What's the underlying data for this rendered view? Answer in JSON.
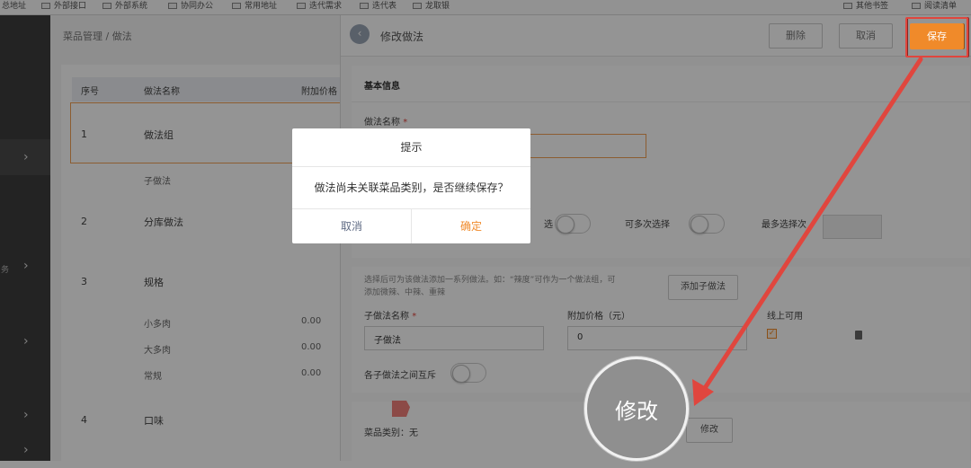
{
  "bookmarks": [
    {
      "label": "总地址"
    },
    {
      "label": "外部接口"
    },
    {
      "label": "外部系统"
    },
    {
      "label": "协同办公"
    },
    {
      "label": "常用地址"
    },
    {
      "label": "迭代需求"
    },
    {
      "label": "迭代表"
    },
    {
      "label": "龙取银"
    },
    {
      "label": "其他书签"
    },
    {
      "label": "阅读清单"
    }
  ],
  "sidebar": {
    "fragment": "务"
  },
  "left_panel": {
    "breadcrumb": "菜品管理 /  做法",
    "columns": [
      "序号",
      "做法名称",
      "附加价格"
    ],
    "groups": [
      {
        "index": "1",
        "name": "做法组",
        "children": [
          {
            "name": "子做法",
            "price": ""
          }
        ]
      },
      {
        "index": "2",
        "name": "分库做法",
        "children": []
      },
      {
        "index": "3",
        "name": "规格",
        "children": [
          {
            "name": "小多肉",
            "price": "0.00"
          },
          {
            "name": "大多肉",
            "price": "0.00"
          },
          {
            "name": "常规",
            "price": "0.00"
          }
        ]
      },
      {
        "index": "4",
        "name": "口味",
        "children": []
      }
    ]
  },
  "right_panel": {
    "header": {
      "title": "修改做法",
      "delete_label": "删除",
      "cancel_label": "取消",
      "save_label": "保存"
    },
    "basic_info": {
      "section_title": "基本信息",
      "name_label": "做法名称",
      "required_mark": "*",
      "toggle1_label_fragment": "选",
      "multi_select_label": "可多次选择",
      "max_select_label": "最多选择次"
    },
    "sub_methods": {
      "note_line1": "选择后可为该做法添加一系列做法。如：“辣度”可作为一个做法组，可",
      "note_line2": "添加微辣、中辣、重辣",
      "add_button": "添加子做法",
      "name_label": "子做法名称",
      "required_mark": "*",
      "price_label": "附加价格（元）",
      "online_label": "线上可用",
      "name_value": "子做法",
      "price_value": "0",
      "mutex_label": "各子做法之间互斥"
    },
    "category": {
      "label": "菜品类别：无",
      "edit_button": "修改"
    }
  },
  "dialog": {
    "title": "提示",
    "message": "做法尚未关联菜品类别，是否继续保存？",
    "cancel_label": "取消",
    "confirm_label": "确定"
  },
  "annotation": {
    "zoom_label": "修改",
    "arrow_color": "#e0463e"
  },
  "colors": {
    "accent": "#f08a2a",
    "highlight": "#e0463e",
    "sidebar": "#3d3d3d"
  }
}
